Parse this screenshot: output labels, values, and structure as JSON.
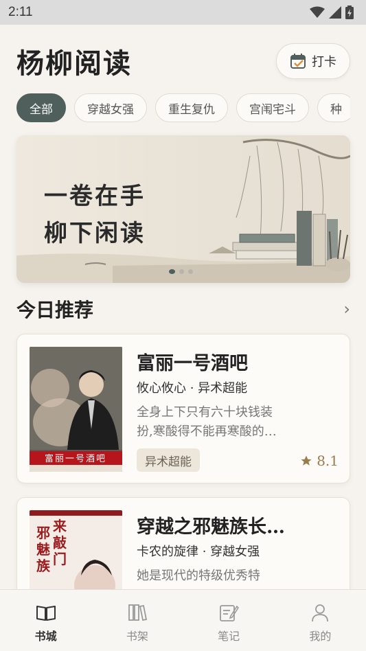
{
  "status_bar": {
    "time": "2:11"
  },
  "header": {
    "title": "杨柳阅读",
    "checkin_label": "打卡"
  },
  "categories": [
    {
      "label": "全部",
      "active": true
    },
    {
      "label": "穿越女强"
    },
    {
      "label": "重生复仇"
    },
    {
      "label": "宫闱宅斗"
    },
    {
      "label": "种"
    }
  ],
  "banner": {
    "line1": "一卷在手",
    "line2": "柳下闲读",
    "pages": 3,
    "current_page": 1
  },
  "section": {
    "title": "今日推荐",
    "more_icon": "chevron-right-icon"
  },
  "books": [
    {
      "title": "富丽一号酒吧",
      "meta": "攸心攸心 · 异术超能",
      "desc_line1": "全身上下只有六十块钱装",
      "desc_line2": "扮,寒酸得不能再寒酸的…",
      "tag": "异术超能",
      "rating": "8.1",
      "cover_text": "富丽一号酒吧"
    },
    {
      "title": "穿越之邪魅族长…",
      "meta": "卡农的旋律 · 穿越女强",
      "desc_line1": "她是现代的特级优秀特"
    }
  ],
  "tabs": [
    {
      "label": "书城",
      "icon": "book-open-icon",
      "active": true
    },
    {
      "label": "书架",
      "icon": "bookshelf-icon"
    },
    {
      "label": "笔记",
      "icon": "note-icon"
    },
    {
      "label": "我的",
      "icon": "user-icon"
    }
  ],
  "colors": {
    "accent": "#4f5f5b",
    "rating": "#9a7b4b",
    "background": "#f6f3ee"
  }
}
